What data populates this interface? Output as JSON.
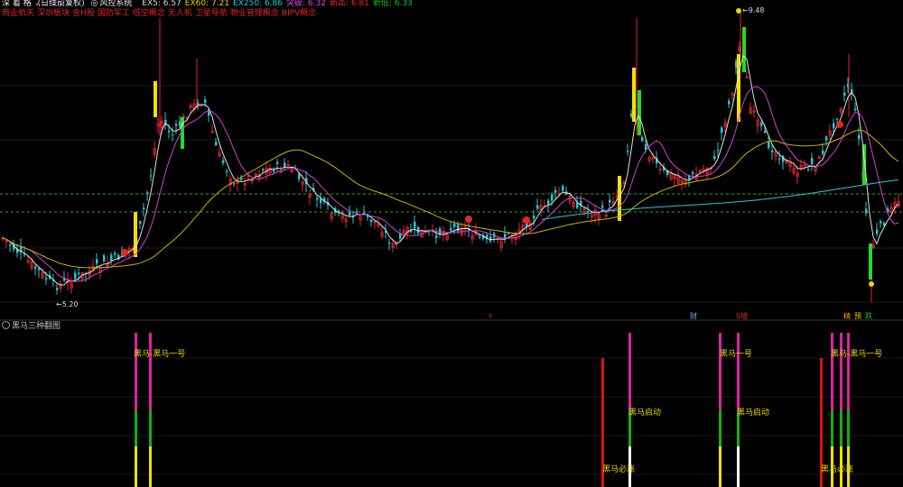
{
  "header": {
    "code_name": "深 着 格",
    "indicator_name": "(日线前复权)",
    "system_name": "风控系统",
    "ma_values": [
      {
        "label": "EX5:",
        "value": "6.57",
        "color": "#d9d9d9"
      },
      {
        "label": "EX60:",
        "value": "7.21",
        "color": "#e8d200"
      },
      {
        "label": "EX250:",
        "value": "6.86",
        "color": "#29c6d6"
      },
      {
        "label": "突破:",
        "value": "6.32",
        "color": "#e040e0"
      },
      {
        "label": "新高:",
        "value": "6.81",
        "color": "#e4262a"
      },
      {
        "label": "新低:",
        "value": "6.33",
        "color": "#1ec21e"
      }
    ]
  },
  "concept_tags": [
    "商业航天",
    "深圳板块",
    "含H股",
    "国防军工",
    "低空概念",
    "无人机",
    "卫星导航",
    "物业管理概念",
    "BIPV概念"
  ],
  "main_chart": {
    "high_label": "9.48",
    "low_label": "5.20",
    "bottom_markers": [
      {
        "text": "s",
        "color": "#e4262a"
      },
      {
        "text": "财",
        "color": "#7fa8ff"
      },
      {
        "text": "S增",
        "color": "#e4262a"
      },
      {
        "text": "精",
        "color": "#ff8c00"
      },
      {
        "text": "预",
        "color": "#e8d200"
      },
      {
        "text": "跌",
        "color": "#1ec21e"
      }
    ]
  },
  "sub_chart": {
    "title": "黑马三种翻图",
    "signal_labels": [
      {
        "text": "黑马-黑马一号"
      },
      {
        "text": "黑马一号"
      },
      {
        "text": "黑马-黑马一号"
      },
      {
        "text": "黑马启动"
      },
      {
        "text": "黑马启动"
      },
      {
        "text": "黑马必涨"
      },
      {
        "text": "黑马必涨"
      }
    ]
  },
  "colors": {
    "up": "#e4262a",
    "down": "#29c6d6",
    "ma5": "#e0e0e0",
    "ma_mid": "#d040d0",
    "ma_long": "#c8b400",
    "ma_250": "#29c6d6",
    "grid": "#2a2a2a",
    "hline": "#1fa81f"
  }
}
